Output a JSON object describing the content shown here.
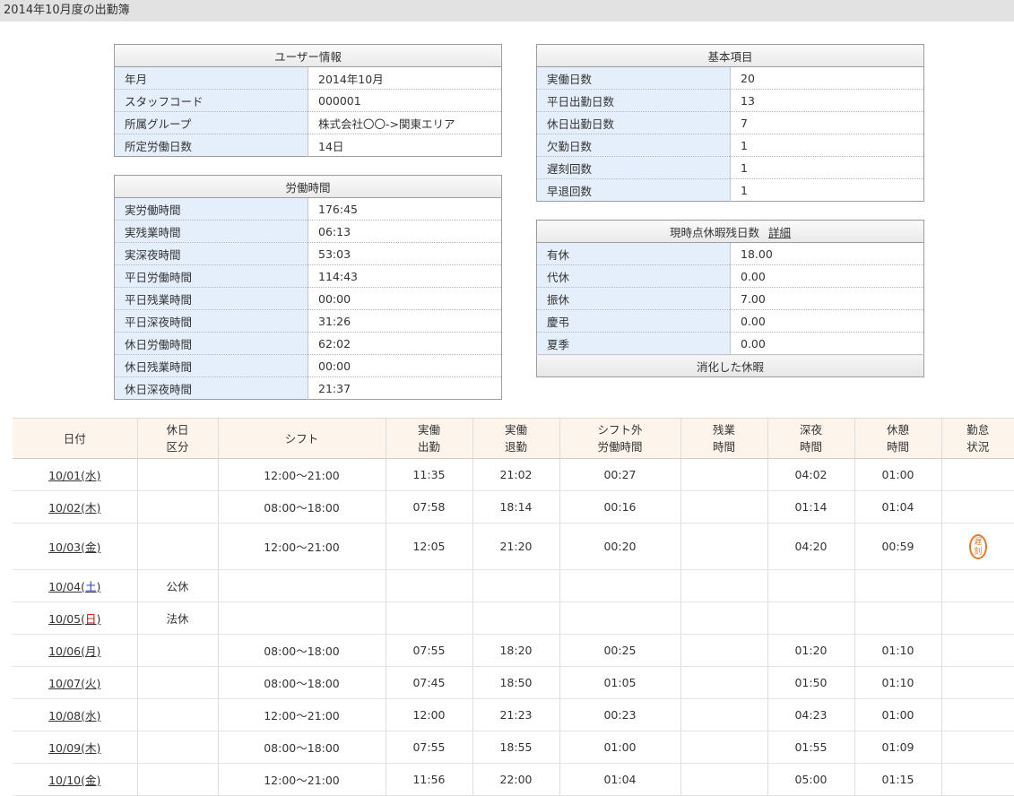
{
  "page_title": "2014年10月度の出勤簿",
  "user_info": {
    "header": "ユーザー情報",
    "rows": [
      {
        "label": "年月",
        "value": "2014年10月"
      },
      {
        "label": "スタッフコード",
        "value": "000001"
      },
      {
        "label": "所属グループ",
        "value": "株式会社〇〇->関東エリア"
      },
      {
        "label": "所定労働日数",
        "value": "14日"
      }
    ]
  },
  "work_time": {
    "header": "労働時間",
    "rows": [
      {
        "label": "実労働時間",
        "value": "176:45"
      },
      {
        "label": "実残業時間",
        "value": "06:13"
      },
      {
        "label": "実深夜時間",
        "value": "53:03"
      },
      {
        "label": "平日労働時間",
        "value": "114:43"
      },
      {
        "label": "平日残業時間",
        "value": "00:00"
      },
      {
        "label": "平日深夜時間",
        "value": "31:26"
      },
      {
        "label": "休日労働時間",
        "value": "62:02"
      },
      {
        "label": "休日残業時間",
        "value": "00:00"
      },
      {
        "label": "休日深夜時間",
        "value": "21:37"
      }
    ]
  },
  "basic_items": {
    "header": "基本項目",
    "rows": [
      {
        "label": "実働日数",
        "value": "20"
      },
      {
        "label": "平日出勤日数",
        "value": "13"
      },
      {
        "label": "休日出勤日数",
        "value": "7"
      },
      {
        "label": "欠勤日数",
        "value": "1"
      },
      {
        "label": "遅刻回数",
        "value": "1"
      },
      {
        "label": "早退回数",
        "value": "1"
      }
    ]
  },
  "leave": {
    "header": "現時点休暇残日数",
    "detail_link": "詳細",
    "rows": [
      {
        "label": "有休",
        "value": "18.00"
      },
      {
        "label": "代休",
        "value": "0.00"
      },
      {
        "label": "振休",
        "value": "7.00"
      },
      {
        "label": "慶弔",
        "value": "0.00"
      },
      {
        "label": "夏季",
        "value": "0.00"
      }
    ],
    "footer": "消化した休暇"
  },
  "attendance": {
    "headers": {
      "date": "日付",
      "holiday_type_1": "休日",
      "holiday_type_2": "区分",
      "shift": "シフト",
      "clock_in_1": "実働",
      "clock_in_2": "出勤",
      "clock_out_1": "実働",
      "clock_out_2": "退勤",
      "extra_1": "シフト外",
      "extra_2": "労働時間",
      "overtime_1": "残業",
      "overtime_2": "時間",
      "night_1": "深夜",
      "night_2": "時間",
      "break_1": "休憩",
      "break_2": "時間",
      "status_1": "勤怠",
      "status_2": "状況"
    },
    "rows": [
      {
        "md": "10/01",
        "dow": "水",
        "dow_type": "weekday",
        "holiday": "",
        "shift": "12:00～21:00",
        "in": "11:35",
        "out": "21:02",
        "extra": "00:27",
        "overtime": "",
        "night": "04:02",
        "break": "01:00",
        "status": ""
      },
      {
        "md": "10/02",
        "dow": "木",
        "dow_type": "weekday",
        "holiday": "",
        "shift": "08:00～18:00",
        "in": "07:58",
        "out": "18:14",
        "extra": "00:16",
        "overtime": "",
        "night": "01:14",
        "break": "01:04",
        "status": ""
      },
      {
        "md": "10/03",
        "dow": "金",
        "dow_type": "weekday",
        "holiday": "",
        "shift": "12:00～21:00",
        "in": "12:05",
        "out": "21:20",
        "extra": "00:20",
        "overtime": "",
        "night": "04:20",
        "break": "00:59",
        "status": "遅刻"
      },
      {
        "md": "10/04",
        "dow": "土",
        "dow_type": "sat",
        "holiday": "公休",
        "shift": "",
        "in": "",
        "out": "",
        "extra": "",
        "overtime": "",
        "night": "",
        "break": "",
        "status": ""
      },
      {
        "md": "10/05",
        "dow": "日",
        "dow_type": "sun",
        "holiday": "法休",
        "shift": "",
        "in": "",
        "out": "",
        "extra": "",
        "overtime": "",
        "night": "",
        "break": "",
        "status": ""
      },
      {
        "md": "10/06",
        "dow": "月",
        "dow_type": "weekday",
        "holiday": "",
        "shift": "08:00～18:00",
        "in": "07:55",
        "out": "18:20",
        "extra": "00:25",
        "overtime": "",
        "night": "01:20",
        "break": "01:10",
        "status": ""
      },
      {
        "md": "10/07",
        "dow": "火",
        "dow_type": "weekday",
        "holiday": "",
        "shift": "08:00～18:00",
        "in": "07:45",
        "out": "18:50",
        "extra": "01:05",
        "overtime": "",
        "night": "01:50",
        "break": "01:10",
        "status": ""
      },
      {
        "md": "10/08",
        "dow": "水",
        "dow_type": "weekday",
        "holiday": "",
        "shift": "12:00～21:00",
        "in": "12:00",
        "out": "21:23",
        "extra": "00:23",
        "overtime": "",
        "night": "04:23",
        "break": "01:00",
        "status": ""
      },
      {
        "md": "10/09",
        "dow": "木",
        "dow_type": "weekday",
        "holiday": "",
        "shift": "08:00～18:00",
        "in": "07:55",
        "out": "18:55",
        "extra": "01:00",
        "overtime": "",
        "night": "01:55",
        "break": "01:09",
        "status": ""
      },
      {
        "md": "10/10",
        "dow": "金",
        "dow_type": "weekday",
        "holiday": "",
        "shift": "12:00～21:00",
        "in": "11:56",
        "out": "22:00",
        "extra": "01:04",
        "overtime": "",
        "night": "05:00",
        "break": "01:15",
        "status": ""
      }
    ]
  }
}
